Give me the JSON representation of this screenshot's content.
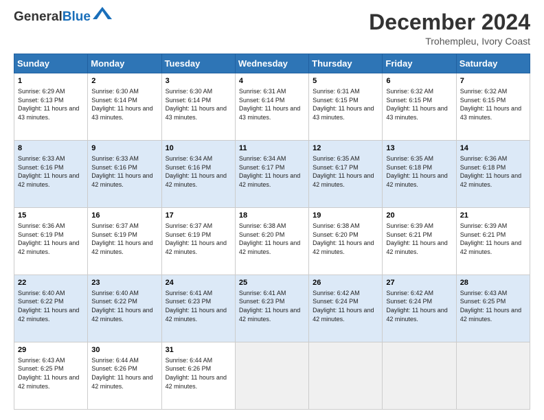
{
  "header": {
    "logo_line1": "General",
    "logo_line2": "Blue",
    "title": "December 2024",
    "location": "Trohempleu, Ivory Coast"
  },
  "days_of_week": [
    "Sunday",
    "Monday",
    "Tuesday",
    "Wednesday",
    "Thursday",
    "Friday",
    "Saturday"
  ],
  "weeks": [
    [
      {
        "day": "1",
        "sunrise": "Sunrise: 6:29 AM",
        "sunset": "Sunset: 6:13 PM",
        "daylight": "Daylight: 11 hours and 43 minutes."
      },
      {
        "day": "2",
        "sunrise": "Sunrise: 6:30 AM",
        "sunset": "Sunset: 6:14 PM",
        "daylight": "Daylight: 11 hours and 43 minutes."
      },
      {
        "day": "3",
        "sunrise": "Sunrise: 6:30 AM",
        "sunset": "Sunset: 6:14 PM",
        "daylight": "Daylight: 11 hours and 43 minutes."
      },
      {
        "day": "4",
        "sunrise": "Sunrise: 6:31 AM",
        "sunset": "Sunset: 6:14 PM",
        "daylight": "Daylight: 11 hours and 43 minutes."
      },
      {
        "day": "5",
        "sunrise": "Sunrise: 6:31 AM",
        "sunset": "Sunset: 6:15 PM",
        "daylight": "Daylight: 11 hours and 43 minutes."
      },
      {
        "day": "6",
        "sunrise": "Sunrise: 6:32 AM",
        "sunset": "Sunset: 6:15 PM",
        "daylight": "Daylight: 11 hours and 43 minutes."
      },
      {
        "day": "7",
        "sunrise": "Sunrise: 6:32 AM",
        "sunset": "Sunset: 6:15 PM",
        "daylight": "Daylight: 11 hours and 43 minutes."
      }
    ],
    [
      {
        "day": "8",
        "sunrise": "Sunrise: 6:33 AM",
        "sunset": "Sunset: 6:16 PM",
        "daylight": "Daylight: 11 hours and 42 minutes."
      },
      {
        "day": "9",
        "sunrise": "Sunrise: 6:33 AM",
        "sunset": "Sunset: 6:16 PM",
        "daylight": "Daylight: 11 hours and 42 minutes."
      },
      {
        "day": "10",
        "sunrise": "Sunrise: 6:34 AM",
        "sunset": "Sunset: 6:16 PM",
        "daylight": "Daylight: 11 hours and 42 minutes."
      },
      {
        "day": "11",
        "sunrise": "Sunrise: 6:34 AM",
        "sunset": "Sunset: 6:17 PM",
        "daylight": "Daylight: 11 hours and 42 minutes."
      },
      {
        "day": "12",
        "sunrise": "Sunrise: 6:35 AM",
        "sunset": "Sunset: 6:17 PM",
        "daylight": "Daylight: 11 hours and 42 minutes."
      },
      {
        "day": "13",
        "sunrise": "Sunrise: 6:35 AM",
        "sunset": "Sunset: 6:18 PM",
        "daylight": "Daylight: 11 hours and 42 minutes."
      },
      {
        "day": "14",
        "sunrise": "Sunrise: 6:36 AM",
        "sunset": "Sunset: 6:18 PM",
        "daylight": "Daylight: 11 hours and 42 minutes."
      }
    ],
    [
      {
        "day": "15",
        "sunrise": "Sunrise: 6:36 AM",
        "sunset": "Sunset: 6:19 PM",
        "daylight": "Daylight: 11 hours and 42 minutes."
      },
      {
        "day": "16",
        "sunrise": "Sunrise: 6:37 AM",
        "sunset": "Sunset: 6:19 PM",
        "daylight": "Daylight: 11 hours and 42 minutes."
      },
      {
        "day": "17",
        "sunrise": "Sunrise: 6:37 AM",
        "sunset": "Sunset: 6:19 PM",
        "daylight": "Daylight: 11 hours and 42 minutes."
      },
      {
        "day": "18",
        "sunrise": "Sunrise: 6:38 AM",
        "sunset": "Sunset: 6:20 PM",
        "daylight": "Daylight: 11 hours and 42 minutes."
      },
      {
        "day": "19",
        "sunrise": "Sunrise: 6:38 AM",
        "sunset": "Sunset: 6:20 PM",
        "daylight": "Daylight: 11 hours and 42 minutes."
      },
      {
        "day": "20",
        "sunrise": "Sunrise: 6:39 AM",
        "sunset": "Sunset: 6:21 PM",
        "daylight": "Daylight: 11 hours and 42 minutes."
      },
      {
        "day": "21",
        "sunrise": "Sunrise: 6:39 AM",
        "sunset": "Sunset: 6:21 PM",
        "daylight": "Daylight: 11 hours and 42 minutes."
      }
    ],
    [
      {
        "day": "22",
        "sunrise": "Sunrise: 6:40 AM",
        "sunset": "Sunset: 6:22 PM",
        "daylight": "Daylight: 11 hours and 42 minutes."
      },
      {
        "day": "23",
        "sunrise": "Sunrise: 6:40 AM",
        "sunset": "Sunset: 6:22 PM",
        "daylight": "Daylight: 11 hours and 42 minutes."
      },
      {
        "day": "24",
        "sunrise": "Sunrise: 6:41 AM",
        "sunset": "Sunset: 6:23 PM",
        "daylight": "Daylight: 11 hours and 42 minutes."
      },
      {
        "day": "25",
        "sunrise": "Sunrise: 6:41 AM",
        "sunset": "Sunset: 6:23 PM",
        "daylight": "Daylight: 11 hours and 42 minutes."
      },
      {
        "day": "26",
        "sunrise": "Sunrise: 6:42 AM",
        "sunset": "Sunset: 6:24 PM",
        "daylight": "Daylight: 11 hours and 42 minutes."
      },
      {
        "day": "27",
        "sunrise": "Sunrise: 6:42 AM",
        "sunset": "Sunset: 6:24 PM",
        "daylight": "Daylight: 11 hours and 42 minutes."
      },
      {
        "day": "28",
        "sunrise": "Sunrise: 6:43 AM",
        "sunset": "Sunset: 6:25 PM",
        "daylight": "Daylight: 11 hours and 42 minutes."
      }
    ],
    [
      {
        "day": "29",
        "sunrise": "Sunrise: 6:43 AM",
        "sunset": "Sunset: 6:25 PM",
        "daylight": "Daylight: 11 hours and 42 minutes."
      },
      {
        "day": "30",
        "sunrise": "Sunrise: 6:44 AM",
        "sunset": "Sunset: 6:26 PM",
        "daylight": "Daylight: 11 hours and 42 minutes."
      },
      {
        "day": "31",
        "sunrise": "Sunrise: 6:44 AM",
        "sunset": "Sunset: 6:26 PM",
        "daylight": "Daylight: 11 hours and 42 minutes."
      },
      null,
      null,
      null,
      null
    ]
  ]
}
